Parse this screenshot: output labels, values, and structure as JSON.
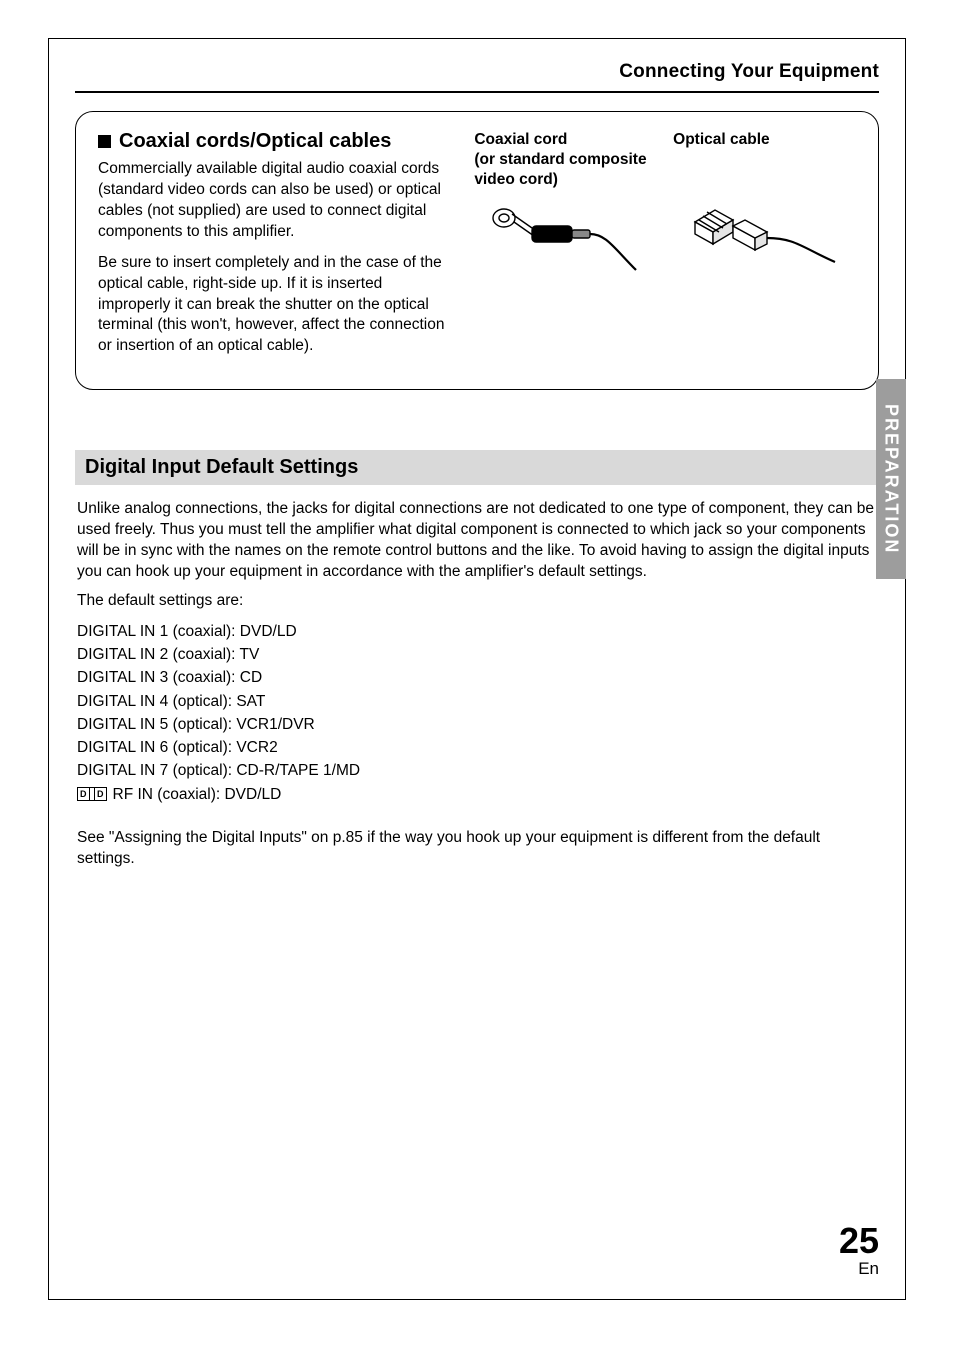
{
  "header": {
    "title": "Connecting Your Equipment"
  },
  "callout": {
    "heading": "Coaxial cords/Optical cables",
    "para1": "Commercially available digital audio coaxial cords (standard video cords can also be used) or optical cables (not supplied) are used to connect digital components to this amplifier.",
    "para2": "Be sure to insert completely and in the case of the optical cable, right-side up. If it is inserted improperly it can break the shutter on the optical terminal (this won't, however, affect the connection or insertion of an optical cable).",
    "coaxial_label_line1": "Coaxial cord",
    "coaxial_label_line2": "(or standard composite video cord)",
    "optical_label": "Optical cable"
  },
  "section": {
    "heading": "Digital Input Default Settings",
    "intro": "Unlike analog connections, the jacks for digital connections are not dedicated to one type of component, they can be used freely. Thus you must tell the amplifier what digital component is connected to which jack so your components will be in sync with the names on the remote control buttons and the like. To avoid having to assign the digital inputs you can hook up your equipment in accordance with the amplifier's default settings.",
    "defaults_intro": "The default settings are:",
    "defaults": [
      "DIGITAL IN 1 (coaxial): DVD/LD",
      "DIGITAL IN 2 (coaxial): TV",
      "DIGITAL IN 3 (coaxial): CD",
      "DIGITAL IN 4 (optical): SAT",
      "DIGITAL IN 5 (optical): VCR1/DVR",
      "DIGITAL IN 6 (optical): VCR2",
      "DIGITAL IN 7 (optical): CD-R/TAPE 1/MD"
    ],
    "dolby_line": "RF IN (coaxial): DVD/LD",
    "ref": "See \"Assigning the Digital Inputs\" on p.85 if the way you hook up your equipment is different from the default settings."
  },
  "sidetab": {
    "label": "PREPARATION"
  },
  "footer": {
    "page_number": "25",
    "lang": "En"
  }
}
